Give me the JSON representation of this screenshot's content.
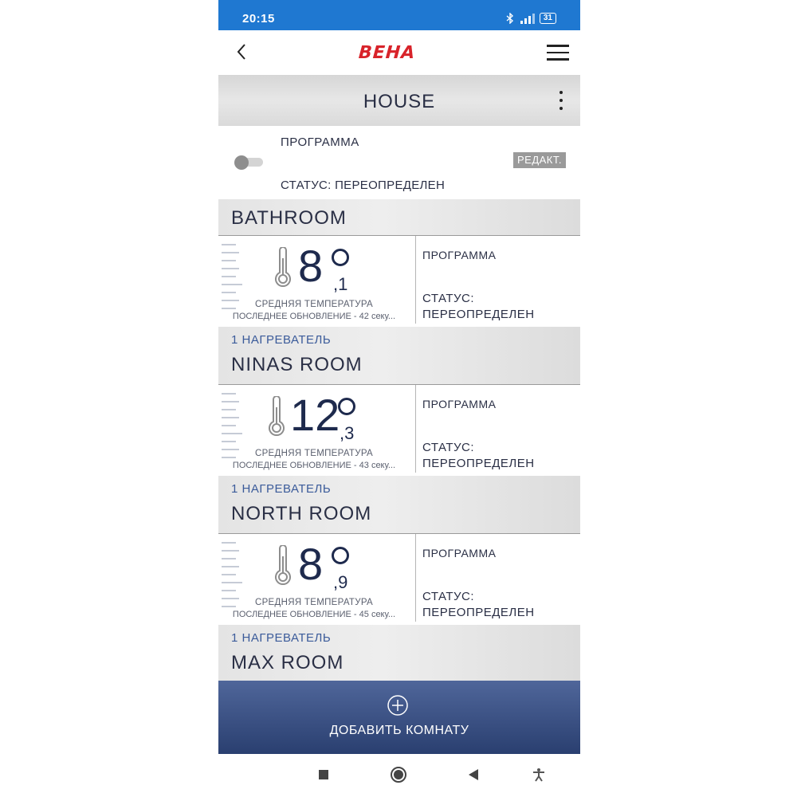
{
  "status_bar": {
    "time": "20:15",
    "battery": "31"
  },
  "app_bar": {
    "logo_text": "BEHA",
    "logo_color": "#d8232a"
  },
  "house": {
    "title": "HOUSE"
  },
  "program_row": {
    "program_label": "ПРОГРАММА",
    "status_label": "СТАТУС: ПЕРЕОПРЕДЕЛЕН",
    "edit_button": "РЕДАКТ.",
    "toggle_on": false
  },
  "rooms": [
    {
      "name": "BATHROOM",
      "temp_int": "8",
      "temp_dec": ",1",
      "avg_label": "СРЕДНЯЯ ТЕМПЕРАТУРА",
      "update_label": "ПОСЛЕДНЕЕ ОБНОВЛЕНИЕ - 42 секу...",
      "program_label": "ПРОГРАММА",
      "status_line1": "СТАТУС:",
      "status_line2": "ПЕРЕОПРЕДЕЛЕН",
      "heaters": "1 НАГРЕВАТЕЛЬ"
    },
    {
      "name": "NINAS ROOM",
      "temp_int": "12",
      "temp_dec": ",3",
      "avg_label": "СРЕДНЯЯ ТЕМПЕРАТУРА",
      "update_label": "ПОСЛЕДНЕЕ ОБНОВЛЕНИЕ - 43 секу...",
      "program_label": "ПРОГРАММА",
      "status_line1": "СТАТУС:",
      "status_line2": "ПЕРЕОПРЕДЕЛЕН",
      "heaters": "1 НАГРЕВАТЕЛЬ"
    },
    {
      "name": "NORTH ROOM",
      "temp_int": "8",
      "temp_dec": ",9",
      "avg_label": "СРЕДНЯЯ ТЕМПЕРАТУРА",
      "update_label": "ПОСЛЕДНЕЕ ОБНОВЛЕНИЕ - 45 секу...",
      "program_label": "ПРОГРАММА",
      "status_line1": "СТАТУС:",
      "status_line2": "ПЕРЕОПРЕДЕЛЕН",
      "heaters": "1 НАГРЕВАТЕЛЬ"
    },
    {
      "name": "MAX ROOM"
    }
  ],
  "add_room": {
    "label": "ДОБАВИТЬ КОМНАТУ"
  },
  "nav": {
    "icons": [
      "square-icon",
      "circle-icon",
      "back-triangle-icon",
      "accessibility-icon"
    ]
  },
  "colors": {
    "status_bar": "#1f78d1",
    "accent_text": "#2a2f45",
    "heater_text": "#3b5b9a",
    "add_room_bg": "#2a3f70"
  }
}
